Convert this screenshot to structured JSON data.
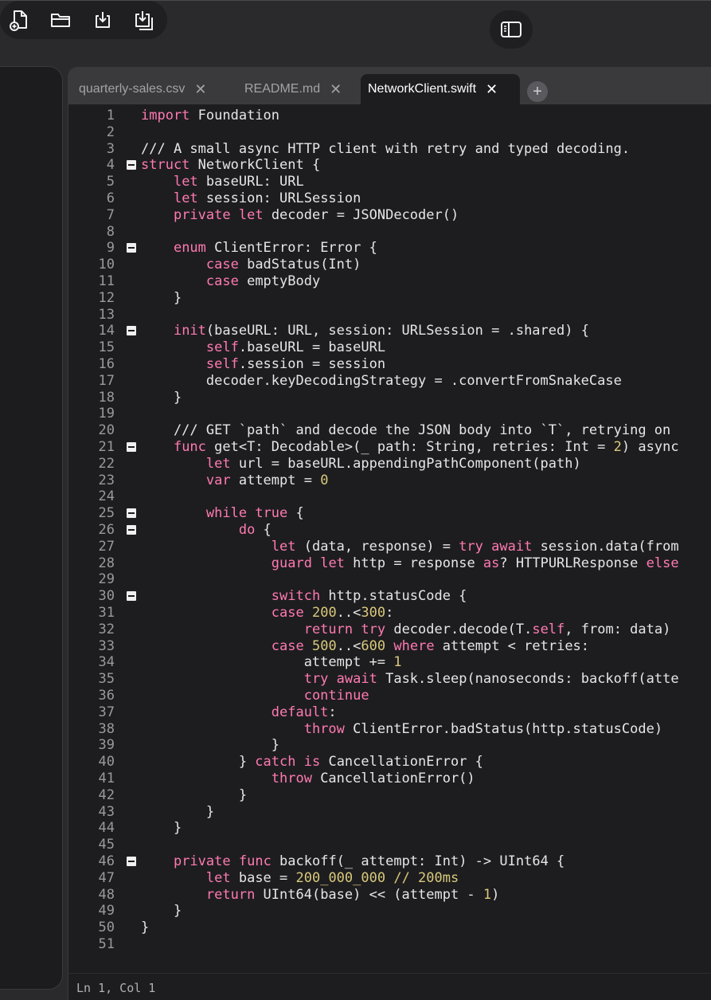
{
  "toolbar": {
    "buttons": [
      {
        "icon": "sidebar-toggle-icon"
      },
      {
        "icon": "new-file-icon"
      },
      {
        "icon": "open-folder-icon"
      },
      {
        "icon": "download-icon"
      },
      {
        "icon": "save-icon"
      }
    ]
  },
  "tabs": [
    {
      "label": "quarterly-sales.csv",
      "close": "✕",
      "active": false
    },
    {
      "label": "README.md",
      "close": "✕",
      "active": false
    },
    {
      "label": "NetworkClient.swift",
      "close": "✕",
      "active": true
    }
  ],
  "add_tab_label": "+",
  "editor": {
    "lines": [
      "import Foundation",
      "",
      "/// A small async HTTP client with retry and typed decoding.",
      "struct NetworkClient {",
      "    let baseURL: URL",
      "    let session: URLSession",
      "    private let decoder = JSONDecoder()",
      "",
      "    enum ClientError: Error {",
      "        case badStatus(Int)",
      "        case emptyBody",
      "    }",
      "",
      "    init(baseURL: URL, session: URLSession = .shared) {",
      "        self.baseURL = baseURL",
      "        self.session = session",
      "        decoder.keyDecodingStrategy = .convertFromSnakeCase",
      "    }",
      "",
      "    /// GET `path` and decode the JSON body into `T`, retrying on",
      "    func get<T: Decodable>(_ path: String, retries: Int = 2) async",
      "        let url = baseURL.appendingPathComponent(path)",
      "        var attempt = 0",
      "",
      "        while true {",
      "            do {",
      "                let (data, response) = try await session.data(from",
      "                guard let http = response as? HTTPURLResponse else",
      "",
      "                switch http.statusCode {",
      "                case 200..<300:",
      "                    return try decoder.decode(T.self, from: data)",
      "                case 500..<600 where attempt < retries:",
      "                    attempt += 1",
      "                    try await Task.sleep(nanoseconds: backoff(atte",
      "                    continue",
      "                default:",
      "                    throw ClientError.badStatus(http.statusCode)",
      "                }",
      "            } catch is CancellationError {",
      "                throw CancellationError()",
      "            }",
      "        }",
      "    }",
      "",
      "    private func backoff(_ attempt: Int) -> UInt64 {",
      "        let base = 200_000_000 // 200ms",
      "        return UInt64(base) << (attempt - 1)",
      "    }",
      "}",
      ""
    ],
    "fold_lines": [
      4,
      9,
      14,
      21,
      25,
      26,
      30,
      46
    ]
  },
  "status": {
    "cursor": "Ln 1, Col 1"
  }
}
